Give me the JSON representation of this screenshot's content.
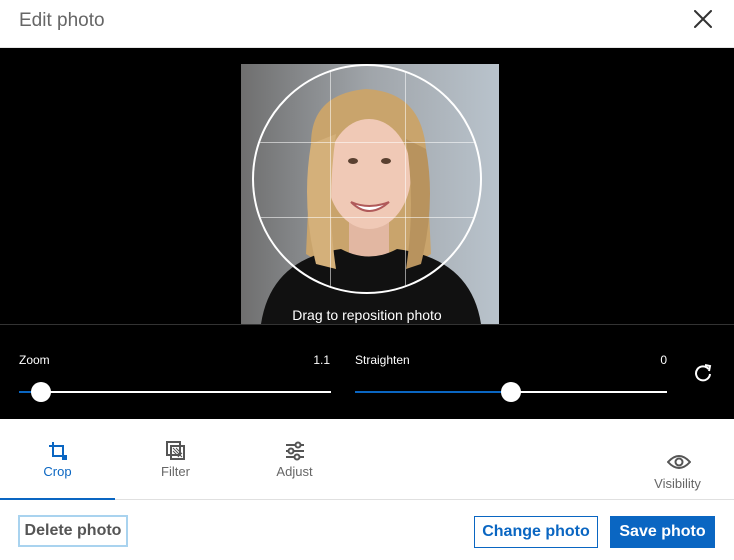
{
  "header": {
    "title": "Edit photo",
    "close_icon": "close-icon"
  },
  "stage": {
    "hint": "Drag to reposition photo"
  },
  "controls": {
    "zoom": {
      "label": "Zoom",
      "value": "1.1",
      "level": 0.07
    },
    "straighten": {
      "label": "Straighten",
      "value": "0",
      "level": 0.5
    },
    "reset_icon": "rotate-reset-icon"
  },
  "tabs": [
    {
      "label": "Crop",
      "icon": "crop-icon",
      "active": true
    },
    {
      "label": "Filter",
      "icon": "filter-icon",
      "active": false
    },
    {
      "label": "Adjust",
      "icon": "sliders-icon",
      "active": false
    },
    {
      "label": "Visibility",
      "icon": "eye-icon",
      "active": false
    }
  ],
  "footer": {
    "delete_label": "Delete photo",
    "change_label": "Change photo",
    "save_label": "Save photo"
  },
  "colors": {
    "accent": "#0a66c2",
    "stage": "#000000"
  }
}
